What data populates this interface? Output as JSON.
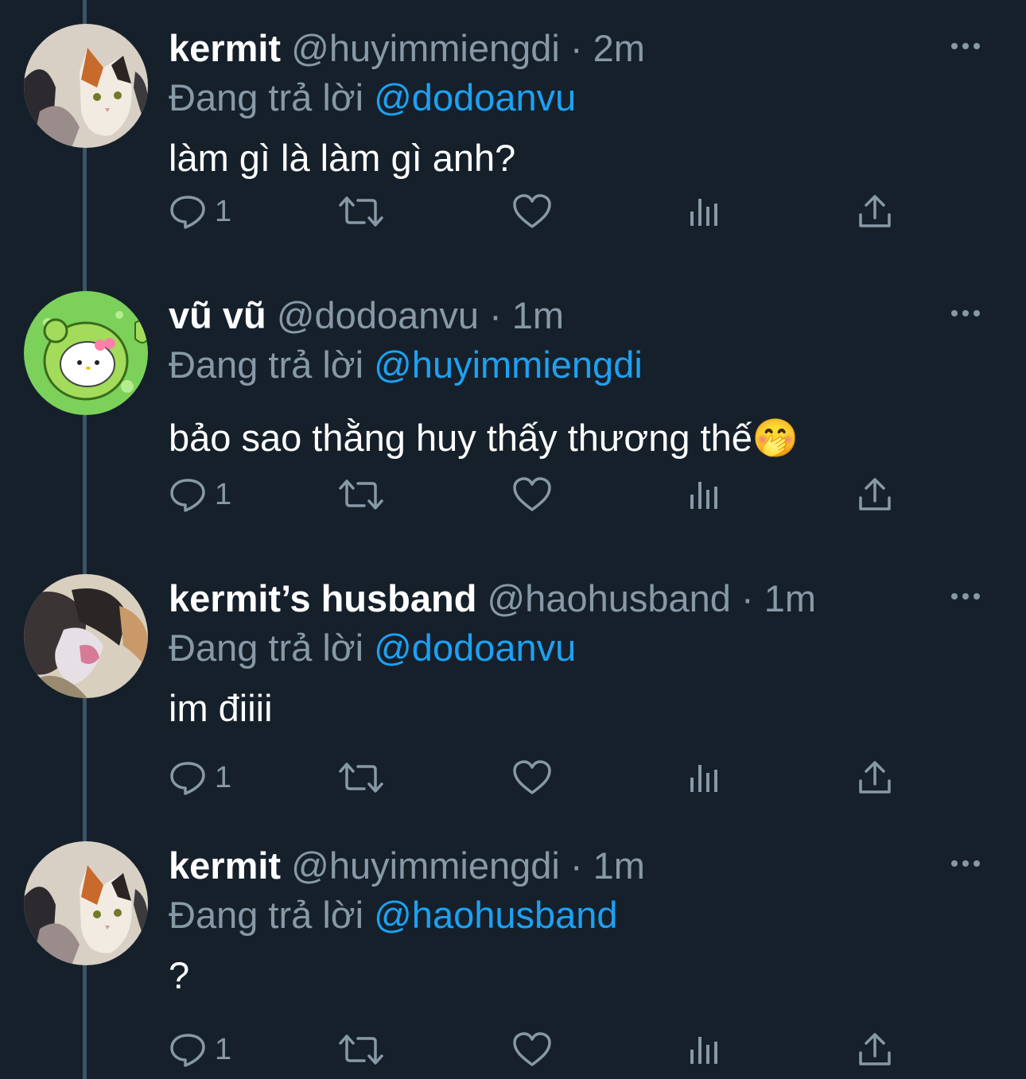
{
  "colors": {
    "background": "#15202b",
    "text_primary": "#ffffff",
    "text_secondary": "#8899a6",
    "accent": "#1da1f2",
    "thread_line": "#3d5466"
  },
  "tweets": [
    {
      "display_name": "kermit",
      "handle": "@huyimmiengdi",
      "separator": "·",
      "time": "2m",
      "replying_prefix": "Đang trả lời",
      "replying_to": "@dodoanvu",
      "text": "làm gì là làm gì anh?",
      "reply_count": "1",
      "avatar_icon": "calico-cat-avatar"
    },
    {
      "display_name": "vũ vũ",
      "handle": "@dodoanvu",
      "separator": "·",
      "time": "1m",
      "replying_prefix": "Đang trả lời",
      "replying_to": "@huyimmiengdi",
      "text": "bảo sao thằng huy thấy thương thế🤭",
      "reply_count": "1",
      "avatar_icon": "hello-kitty-frog-avatar"
    },
    {
      "display_name": "kermit’s husband",
      "handle": "@haohusband",
      "separator": "·",
      "time": "1m",
      "replying_prefix": "Đang trả lời",
      "replying_to": "@dodoanvu",
      "text": "im điiii",
      "reply_count": "1",
      "avatar_icon": "blurry-cat-avatar"
    },
    {
      "display_name": "kermit",
      "handle": "@huyimmiengdi",
      "separator": "·",
      "time": "1m",
      "replying_prefix": "Đang trả lời",
      "replying_to": "@haohusband",
      "text": "?",
      "reply_count": "1",
      "avatar_icon": "calico-cat-avatar"
    }
  ]
}
